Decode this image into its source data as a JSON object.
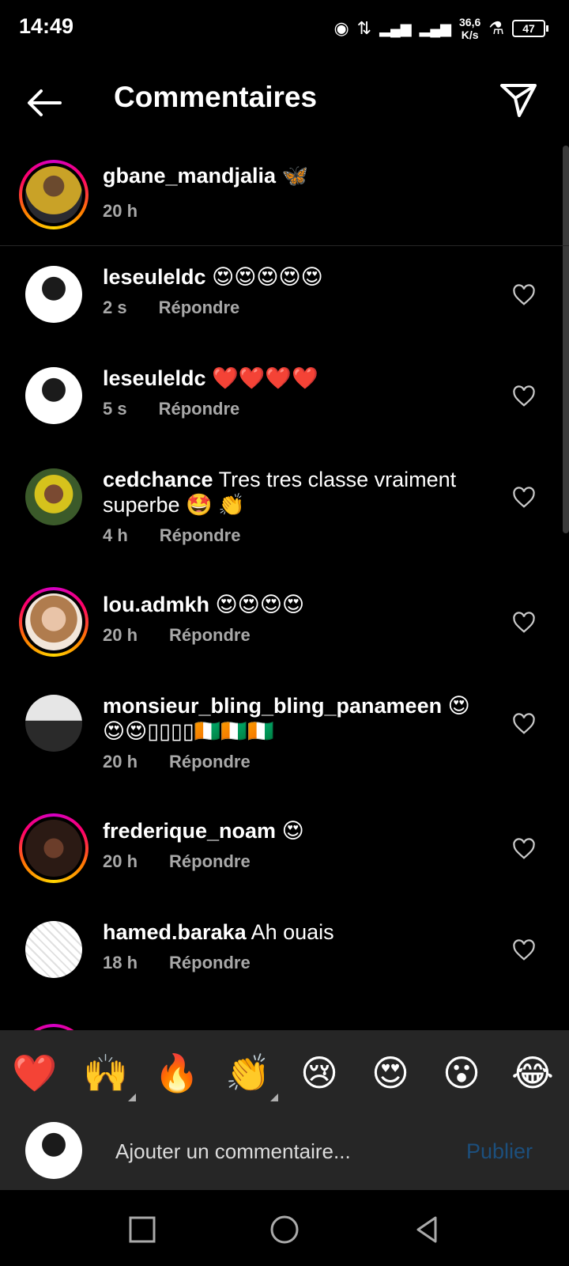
{
  "status": {
    "time": "14:49",
    "network": "4G",
    "speed_value": "36,6",
    "speed_unit": "K/s",
    "battery": "47"
  },
  "header": {
    "title": "Commentaires"
  },
  "caption": {
    "username": "gbane_mandjalia",
    "text": "🦋",
    "time": "20 h"
  },
  "comments": [
    {
      "username": "leseuleldc",
      "text": "😍😍😍😍😍",
      "time": "2 s",
      "reply": "Répondre"
    },
    {
      "username": "leseuleldc",
      "text": "❤️❤️❤️❤️",
      "time": "5 s",
      "reply": "Répondre"
    },
    {
      "username": "cedchance",
      "text": "Tres tres classe vraiment superbe 🤩 👏",
      "time": "4 h",
      "reply": "Répondre"
    },
    {
      "username": "lou.admkh",
      "text": "😍😍😍😍",
      "time": "20 h",
      "reply": "Répondre"
    },
    {
      "username": "monsieur_bling_bling_panameen",
      "text": "😍😍😍▯▯▯▯🇨🇮🇨🇮🇨🇮",
      "time": "20 h",
      "reply": "Répondre"
    },
    {
      "username": "frederique_noam",
      "text": "😍",
      "time": "20 h",
      "reply": "Répondre"
    },
    {
      "username": "hamed.baraka",
      "text": "Ah ouais",
      "time": "18 h",
      "reply": "Répondre"
    }
  ],
  "emojis": [
    "❤️",
    "🙌",
    "🔥",
    "👏",
    "😢",
    "😍",
    "😮",
    "😂"
  ],
  "input": {
    "placeholder": "Ajouter un commentaire...",
    "publish": "Publier"
  },
  "colors": {
    "background": "#000000",
    "panel": "#262626",
    "secondary_text": "#a8a8a8",
    "publish_disabled": "#1c4f7d"
  }
}
